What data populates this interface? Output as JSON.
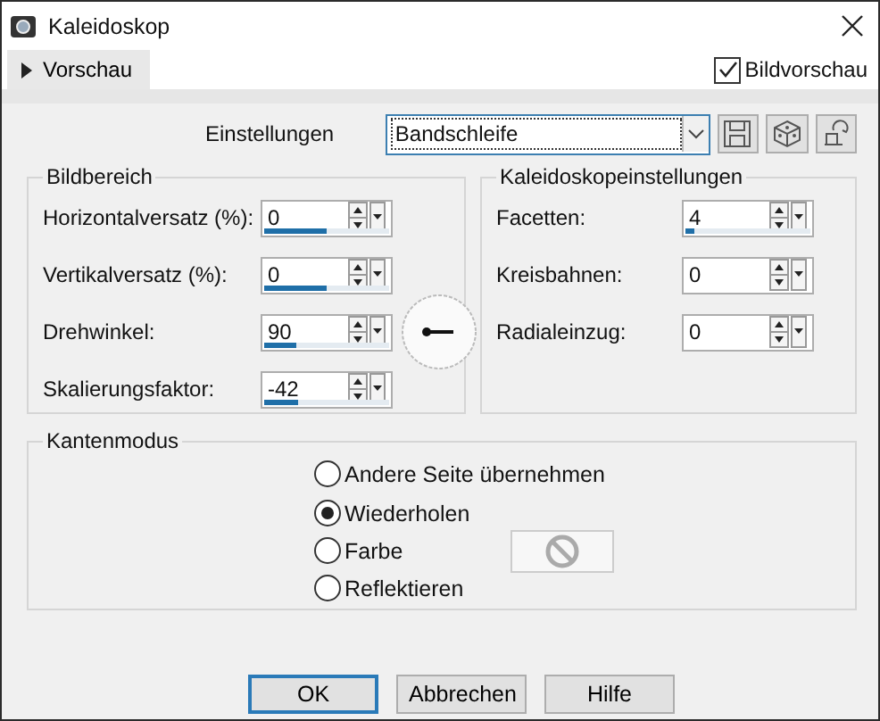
{
  "window": {
    "title": "Kaleidoskop"
  },
  "preview": {
    "toggle_label": "Vorschau",
    "expanded": false,
    "image_preview": {
      "label": "Bildvorschau",
      "checked": true
    }
  },
  "settings": {
    "label": "Einstellungen",
    "value": "Bandschleife",
    "focused": true
  },
  "groups": [
    {
      "title": "Bildbereich",
      "fields": [
        {
          "label": "Horizontalversatz (%):",
          "value": "0",
          "level": 0.5
        },
        {
          "label": "Vertikalversatz (%):",
          "value": "0",
          "level": 0.5
        },
        {
          "label": "Drehwinkel:",
          "value": "90",
          "level": 0.25
        },
        {
          "label": "Skalierungsfaktor:",
          "value": "-42",
          "level": 0.27
        }
      ]
    },
    {
      "title": "Kaleidoskopeinstellungen",
      "fields": [
        {
          "label": "Facetten:",
          "value": "4",
          "level": 0.07
        },
        {
          "label": "Kreisbahnen:",
          "value": "0"
        },
        {
          "label": "Radialeinzug:",
          "value": "0"
        }
      ]
    }
  ],
  "edge_mode": {
    "title": "Kantenmodus",
    "options": [
      {
        "label": "Andere Seite übernehmen",
        "selected": false
      },
      {
        "label": "Wiederholen",
        "selected": true
      },
      {
        "label": "Farbe",
        "selected": false,
        "kind": "color"
      },
      {
        "label": "Reflektieren",
        "selected": false
      }
    ],
    "color_enabled": false
  },
  "buttons": [
    {
      "label": "OK",
      "default": true
    },
    {
      "label": "Abbrechen",
      "default": false
    },
    {
      "label": "Hilfe",
      "default": false
    }
  ]
}
